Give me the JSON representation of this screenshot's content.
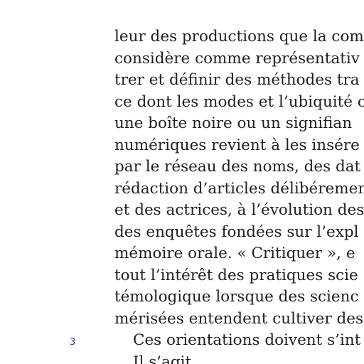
{
  "body": {
    "lines": [
      "leur des productions que la com",
      "considère comme représentativ",
      "trer et définir des méthodes tra",
      "ce dont les modes et l’ubiquité c",
      "une boîte noire ou un signifian",
      "numériques revient à les insére",
      "par le réseau des noms, des dat",
      "rédaction d’articles délibéremen",
      "et des actrices, à l’évolution des",
      "des enquêtes fondées sur l’expl",
      "mémoire orale. « Critiquer », e",
      "tout l’intérêt des pratiques scie",
      "témologique lorsque des scienc",
      "mérisées entendent cultiver des",
      "Ces orientations doivent s’int",
      "Il s’agit ... "
    ]
  },
  "margin": {
    "note_number": "3"
  }
}
